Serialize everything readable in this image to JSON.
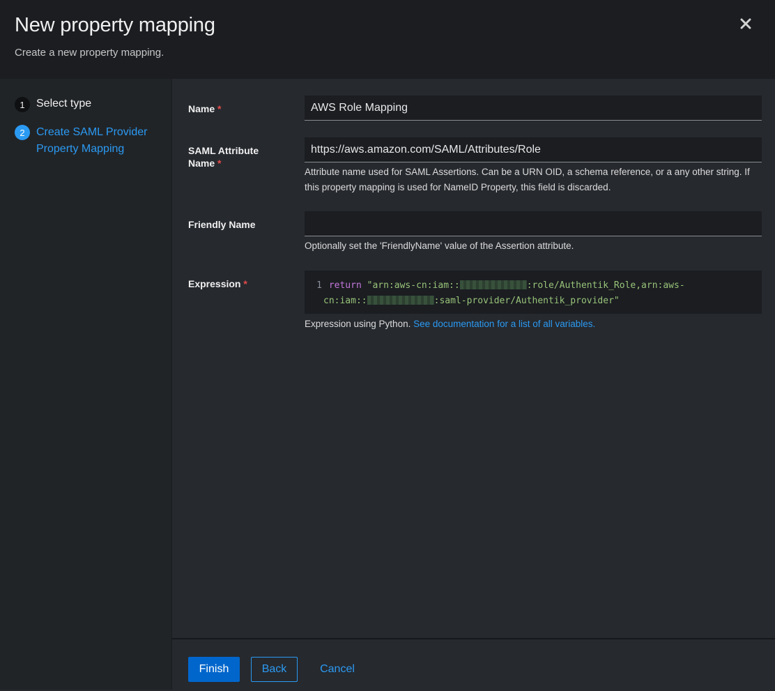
{
  "modal": {
    "title": "New property mapping",
    "subtitle": "Create a new property mapping."
  },
  "icons": {
    "close": "close-icon"
  },
  "wizard": {
    "steps": [
      {
        "number": "1",
        "label": "Select type"
      },
      {
        "number": "2",
        "label": "Create SAML Provider Property Mapping"
      }
    ],
    "current_step": 2
  },
  "form": {
    "name": {
      "label": "Name",
      "required_mark": "*",
      "value": "AWS Role Mapping"
    },
    "saml_attribute_name": {
      "label": "SAML Attribute Name",
      "required_mark": "*",
      "value": "https://aws.amazon.com/SAML/Attributes/Role",
      "help": "Attribute name used for SAML Assertions. Can be a URN OID, a schema reference, or a any other string. If this property mapping is used for NameID Property, this field is discarded."
    },
    "friendly_name": {
      "label": "Friendly Name",
      "value": "",
      "help": "Optionally set the 'FriendlyName' value of the Assertion attribute."
    },
    "expression": {
      "label": "Expression",
      "required_mark": "*",
      "line_number": "1",
      "keyword": "return",
      "code_part1": "\"arn:aws-cn:iam::",
      "code_part2": ":role/Authentik_Role,arn:aws-",
      "code_part3": "cn:iam::",
      "code_part4": ":saml-provider/Authentik_provider\"",
      "help_text": "Expression using Python.",
      "help_link": "See documentation for a list of all variables."
    }
  },
  "footer": {
    "finish": "Finish",
    "back": "Back",
    "cancel": "Cancel"
  },
  "colors": {
    "accent": "#2b9af3",
    "primary_button": "#0066cc",
    "required": "#e54b4b",
    "background": "#26292e",
    "header_background": "#1b1d21"
  }
}
